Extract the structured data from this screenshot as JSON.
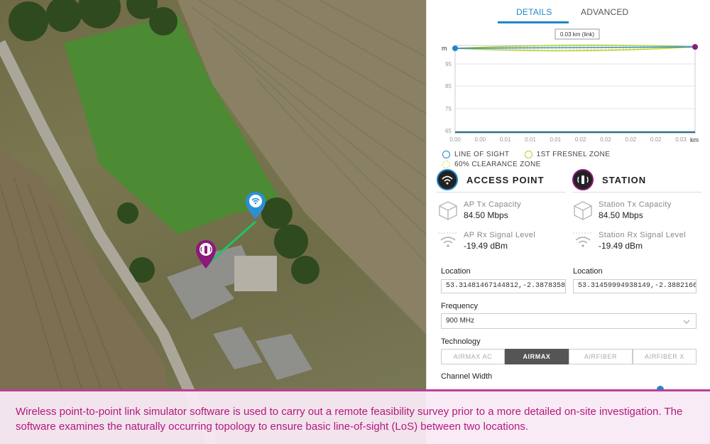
{
  "tabs": [
    "DETAILS",
    "ADVANCED"
  ],
  "chart_data": {
    "type": "line",
    "link_label": "0.03 km (link)",
    "y_unit": "m",
    "x_unit": "km",
    "y_ticks": [
      "95",
      "85",
      "75",
      "65"
    ],
    "x_ticks": [
      "0.00",
      "0.00",
      "0.01",
      "0.01",
      "0.01",
      "0.02",
      "0.02",
      "0.02",
      "0.02",
      "0.03"
    ],
    "series": [
      {
        "name": "LINE OF SIGHT",
        "color": "#1e88c9"
      },
      {
        "name": "1ST FRESNEL ZONE",
        "color": "#b6cf2f"
      },
      {
        "name": "60% CLEARANCE ZONE",
        "color": "#d9dc6a"
      }
    ]
  },
  "legend": [
    "LINE OF SIGHT",
    "1ST FRESNEL ZONE",
    "60% CLEARANCE ZONE"
  ],
  "ap": {
    "title": "ACCESS POINT",
    "tx_label": "AP Tx Capacity",
    "tx_value": "84.50 Mbps",
    "rx_label": "AP Rx Signal Level",
    "rx_value": "-19.49 dBm",
    "location_label": "Location",
    "location_value": "53.31481467144812,-2.3878358"
  },
  "station": {
    "title": "STATION",
    "tx_label": "Station Tx Capacity",
    "tx_value": "84.50 Mbps",
    "rx_label": "Station Rx Signal Level",
    "rx_value": "-19.49 dBm",
    "location_label": "Location",
    "location_value": "53.31459994938149,-2.3882166"
  },
  "frequency": {
    "label": "Frequency",
    "value": "900 MHz"
  },
  "technology": {
    "label": "Technology",
    "options": [
      "AIRMAX AC",
      "AIRMAX",
      "AIRFIBER",
      "AIRFIBER X"
    ],
    "selected": "AIRMAX"
  },
  "channel_width": {
    "label": "Channel Width"
  },
  "caption": "Wireless point-to-point link simulator software is used to carry out a remote feasibility survey prior to a more detailed on-site investigation. The software examines the naturally occurring topology to ensure basic line-of-sight (LoS) between two locations.",
  "colors": {
    "accent": "#1e88c9",
    "station": "#8b1a7a",
    "caption": "#b5177f"
  },
  "icons": {
    "map_ap_pin": "wifi-pin-icon",
    "map_station_pin": "antenna-pin-icon"
  }
}
